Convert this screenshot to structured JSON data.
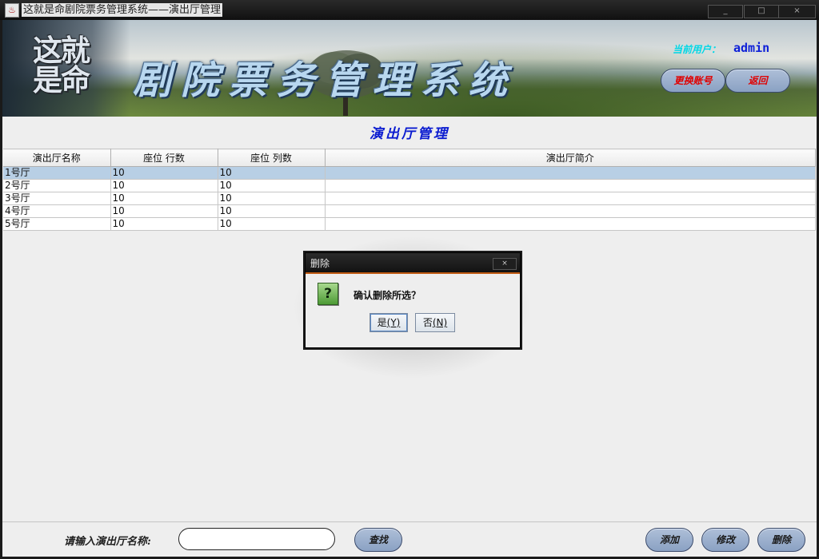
{
  "window": {
    "title": "这就是命剧院票务管理系统——演出厅管理",
    "min_glyph": "_",
    "max_glyph": "□",
    "close_glyph": "×"
  },
  "banner": {
    "logo_text": "这就是命",
    "system_title": "剧院票务管理系统",
    "user_label": "当前用户：",
    "user_name": "admin",
    "switch_account_label": "更换账号",
    "back_label": "返回"
  },
  "page": {
    "title": "演出厅管理"
  },
  "table": {
    "columns": [
      "演出厅名称",
      "座位 行数",
      "座位 列数",
      "演出厅简介"
    ],
    "rows": [
      [
        "1号厅",
        "10",
        "10",
        ""
      ],
      [
        "2号厅",
        "10",
        "10",
        ""
      ],
      [
        "3号厅",
        "10",
        "10",
        ""
      ],
      [
        "4号厅",
        "10",
        "10",
        ""
      ],
      [
        "5号厅",
        "10",
        "10",
        ""
      ]
    ],
    "selected_row_index": 0
  },
  "footer": {
    "search_label": "请输入演出厅名称:",
    "search_value": "",
    "search_button_label": "查找",
    "add_button_label": "添加",
    "edit_button_label": "修改",
    "delete_button_label": "删除"
  },
  "dialog": {
    "title": "删除",
    "icon": "question-icon",
    "message": "确认删除所选？",
    "yes_label": "是",
    "yes_mnemonic": "(Y)",
    "no_label": "否",
    "no_mnemonic": "(N)"
  },
  "colors": {
    "accent_blue": "#0a1bd0",
    "button_red_text": "#e00000",
    "selection": "#b8cfe5",
    "user_label": "#00d7e6"
  }
}
